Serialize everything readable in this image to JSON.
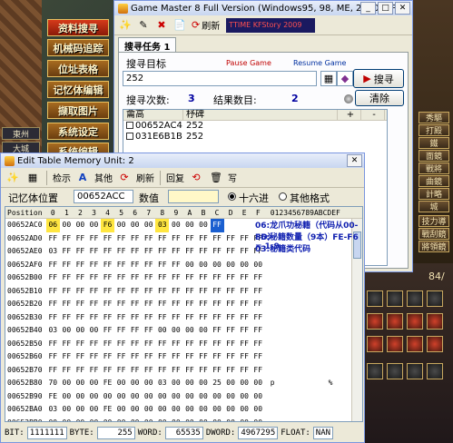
{
  "game": {
    "left_tabs": [
      "東州",
      "大城"
    ],
    "menu": [
      "资料搜寻",
      "机械码追踪",
      "位址表格",
      "记忆体编辑",
      "撷取图片",
      "系统设定",
      "系统编辑"
    ],
    "right_buttons": [
      "秀驅",
      "打殿",
      "鐵",
      "面鏡",
      "戰將",
      "曲鏡",
      "計略",
      "城",
      "技力導",
      "戰刮鏡",
      "將領鏡"
    ],
    "page_indicator": "84/"
  },
  "gm": {
    "title": "Game Master 8 Full Version (Windows95, 98, ME, 2000, XP)",
    "toolbar": {
      "refresh_label": "刷新",
      "ad_text": "TTIME KFStory 2009"
    },
    "tab": "搜寻任务 1",
    "search_target_label": "搜寻目标",
    "pause_game": "Pause Game",
    "resume_game": "Resume Game",
    "search_value": "252",
    "search_button": "搜寻",
    "search_count_label": "搜寻次数:",
    "search_count": "3",
    "result_count_label": "结果数目:",
    "result_count": "2",
    "clear_button": "清除",
    "table": {
      "headers": [
        "龠高",
        "杼碑",
        "+",
        "-"
      ],
      "rows": [
        {
          "addr": "00652AC4",
          "val": "252",
          "plus": "",
          "minus": ""
        },
        {
          "addr": "031E6B1B",
          "val": "252",
          "plus": "",
          "minus": ""
        }
      ]
    }
  },
  "et": {
    "title": "Edit Table  Memory Unit: 2",
    "toolbar": {
      "check": "检示",
      "other": "其他",
      "refresh": "刷新",
      "restore": "回复",
      "write": "写"
    },
    "addr_label": "记忆体位置",
    "addr_value": "00652ACC",
    "value_label": "数值",
    "value_value": "",
    "radix_hex": "十六进",
    "radix_other": "其他格式",
    "hex_header": {
      "position": "Position",
      "cols": [
        "0",
        "1",
        "2",
        "3",
        "4",
        "5",
        "6",
        "7",
        "8",
        "9",
        "A",
        "B",
        "C",
        "D",
        "E",
        "F"
      ],
      "ascii": "0123456789ABCDEF"
    },
    "rows": [
      {
        "addr": "00652AC0",
        "bytes": [
          "06",
          "00",
          "00",
          "00",
          "F6",
          "00",
          "00",
          "00",
          "03",
          "00",
          "00",
          "00",
          "FF",
          "",
          "",
          ""
        ],
        "ascii": ""
      },
      {
        "addr": "00652AD0",
        "bytes": [
          "FF",
          "FF",
          "FF",
          "FF",
          "FF",
          "FF",
          "FF",
          "FF",
          "FF",
          "FF",
          "FF",
          "FF",
          "FF",
          "FF",
          "FF",
          "FF"
        ],
        "ascii": ""
      },
      {
        "addr": "00652AE0",
        "bytes": [
          "03",
          "FF",
          "FF",
          "FF",
          "FF",
          "FF",
          "FF",
          "FF",
          "FF",
          "FF",
          "FF",
          "FF",
          "FF",
          "FF",
          "FF",
          "FF"
        ],
        "ascii": ""
      },
      {
        "addr": "00652AF0",
        "bytes": [
          "FF",
          "FF",
          "FF",
          "FF",
          "FF",
          "FF",
          "FF",
          "FF",
          "FF",
          "FF",
          "00",
          "00",
          "00",
          "00",
          "00",
          "00"
        ],
        "ascii": ""
      },
      {
        "addr": "00652B00",
        "bytes": [
          "FF",
          "FF",
          "FF",
          "FF",
          "FF",
          "FF",
          "FF",
          "FF",
          "FF",
          "FF",
          "FF",
          "FF",
          "FF",
          "FF",
          "FF",
          "FF"
        ],
        "ascii": ""
      },
      {
        "addr": "00652B10",
        "bytes": [
          "FF",
          "FF",
          "FF",
          "FF",
          "FF",
          "FF",
          "FF",
          "FF",
          "FF",
          "FF",
          "FF",
          "FF",
          "FF",
          "FF",
          "FF",
          "FF"
        ],
        "ascii": ""
      },
      {
        "addr": "00652B20",
        "bytes": [
          "FF",
          "FF",
          "FF",
          "FF",
          "FF",
          "FF",
          "FF",
          "FF",
          "FF",
          "FF",
          "FF",
          "FF",
          "FF",
          "FF",
          "FF",
          "FF"
        ],
        "ascii": ""
      },
      {
        "addr": "00652B30",
        "bytes": [
          "FF",
          "FF",
          "FF",
          "FF",
          "FF",
          "FF",
          "FF",
          "FF",
          "FF",
          "FF",
          "FF",
          "FF",
          "FF",
          "FF",
          "FF",
          "FF"
        ],
        "ascii": ""
      },
      {
        "addr": "00652B40",
        "bytes": [
          "03",
          "00",
          "00",
          "00",
          "FF",
          "FF",
          "FF",
          "FF",
          "00",
          "00",
          "00",
          "00",
          "FF",
          "FF",
          "FF",
          "FF"
        ],
        "ascii": ""
      },
      {
        "addr": "00652B50",
        "bytes": [
          "FF",
          "FF",
          "FF",
          "FF",
          "FF",
          "FF",
          "FF",
          "FF",
          "FF",
          "FF",
          "FF",
          "FF",
          "FF",
          "FF",
          "FF",
          "FF"
        ],
        "ascii": ""
      },
      {
        "addr": "00652B60",
        "bytes": [
          "FF",
          "FF",
          "FF",
          "FF",
          "FF",
          "FF",
          "FF",
          "FF",
          "FF",
          "FF",
          "FF",
          "FF",
          "FF",
          "FF",
          "FF",
          "FF"
        ],
        "ascii": ""
      },
      {
        "addr": "00652B70",
        "bytes": [
          "FF",
          "FF",
          "FF",
          "FF",
          "FF",
          "FF",
          "FF",
          "FF",
          "FF",
          "FF",
          "FF",
          "FF",
          "FF",
          "FF",
          "FF",
          "FF"
        ],
        "ascii": ""
      },
      {
        "addr": "00652B80",
        "bytes": [
          "70",
          "00",
          "00",
          "00",
          "FE",
          "00",
          "00",
          "00",
          "03",
          "00",
          "00",
          "00",
          "25",
          "00",
          "00",
          "00"
        ],
        "ascii": "p           %"
      },
      {
        "addr": "00652B90",
        "bytes": [
          "FE",
          "00",
          "00",
          "00",
          "00",
          "00",
          "00",
          "00",
          "00",
          "00",
          "00",
          "00",
          "00",
          "00",
          "00",
          "00"
        ],
        "ascii": ""
      },
      {
        "addr": "00652BA0",
        "bytes": [
          "03",
          "00",
          "00",
          "00",
          "FE",
          "00",
          "00",
          "00",
          "00",
          "00",
          "00",
          "00",
          "00",
          "00",
          "00",
          "00"
        ],
        "ascii": ""
      },
      {
        "addr": "00652BB0",
        "bytes": [
          "00",
          "00",
          "00",
          "00",
          "00",
          "00",
          "00",
          "00",
          "00",
          "00",
          "00",
          "00",
          "00",
          "00",
          "00",
          "00"
        ],
        "ascii": ""
      }
    ],
    "notes": [
      "06:龙爪功秘籍（代码从00-8D）",
      "F6:秘籍数量（9本）FE-F6 = 1-9",
      "03:秘籍类代码"
    ],
    "status": {
      "bit_label": "BIT:",
      "bit": "1111111",
      "byte_label": "BYTE:",
      "byte": "255",
      "word_label": "WORD:",
      "word": "65535",
      "dword_label": "DWORD:",
      "dword": "4967295",
      "float_label": "FLOAT:",
      "float": "NAN"
    }
  }
}
